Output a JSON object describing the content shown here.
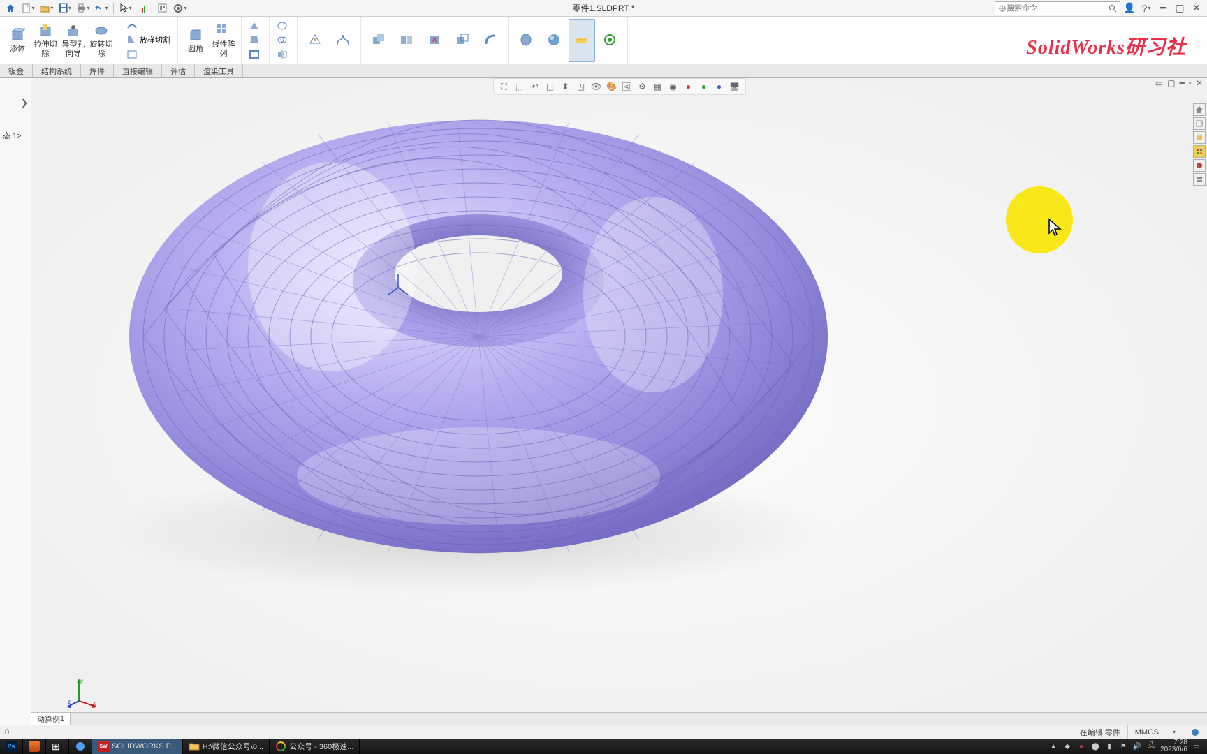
{
  "window": {
    "title": "零件1.SLDPRT *"
  },
  "search": {
    "placeholder": "搜索命令"
  },
  "ribbon": {
    "groups": {
      "g0": {
        "btn1": "添体",
        "btn2": "拉伸切\n除",
        "btn3": "异型孔\n向导",
        "btn4": "旋转切\n除",
        "btn5": "放样切割"
      },
      "sweep": "扫描切除",
      "edge": "边界切除",
      "g1": {
        "b1": "圆角",
        "b2": "线性阵\n列"
      },
      "rib": "筋",
      "draft": "拔模",
      "shell": "抽壳",
      "wrap": "包覆",
      "inter": "相交",
      "mirror": "镜向",
      "refgeo": "参考几\n何体",
      "curve": "曲线",
      "combine": "组合",
      "split": "分割",
      "delkeep": "删除/保\n留实体",
      "movecopy": "移动/复\n制实体",
      "bend": "弯曲",
      "wrap2": "包覆",
      "realview": "RealView\n图形",
      "instant3d": "Instant3D",
      "transname": "特征名\n翻译宏"
    }
  },
  "tabs": {
    "t1": "钣金",
    "t2": "结构系统",
    "t3": "焊件",
    "t4": "直接编辑",
    "t5": "评估",
    "t6": "渲染工具"
  },
  "leftpanel": {
    "text": "态 1>"
  },
  "doc_tabs": {
    "t1_a": "动算例",
    "t1_b": "1",
    "below": ".0"
  },
  "status": {
    "edit": "在编辑 零件",
    "units": "MMGS"
  },
  "watermark": "SolidWorks研习社",
  "taskbar": {
    "sw": "SOLIDWORKS P...",
    "folder": "H:\\微信公众号\\0...",
    "browser": "公众号 - 360极速..."
  },
  "tray": {
    "time": "7:28",
    "date": "2023/6/6"
  }
}
